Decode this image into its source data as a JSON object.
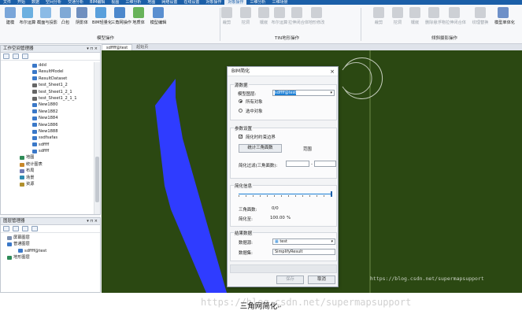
{
  "menu": [
    "文件",
    "开始",
    "数据",
    "空间分析",
    "交通分析",
    "BIM编辑",
    "视图",
    "三维分析",
    "地图",
    "网络设置",
    "在线设置",
    "对象操作",
    "对象操作",
    "三维分析",
    "三维场景"
  ],
  "menu_active": 12,
  "ribbon": {
    "buttons": [
      "建模",
      "布尔运算",
      "截面与投影",
      "凸包",
      "阴影体",
      "BIM轻量化",
      "三角网操作",
      "地质体",
      "模型编辑",
      "裁剪",
      "挖洞",
      "镶嵌",
      "布尔运算",
      "拉伸闭合体",
      "地形修改",
      "裁剪",
      "挖洞",
      "镶嵌",
      "删除悬浮物",
      "拉伸闭合体",
      "纹理替换",
      "模型单体化"
    ],
    "groups": [
      "模型操作",
      "TIN地形操作",
      "倾斜摄影操作"
    ]
  },
  "workspace": {
    "title": "工作空间管理器",
    "tree": [
      "ddd",
      "ResultModel",
      "ResultDataset",
      "test_Sheet1_2",
      "test_Sheet1_2_1",
      "test_Sheet1_2_1_1",
      "New1880",
      "New1882",
      "New1884",
      "New1886",
      "New1888",
      "ssdfsafas",
      "sdffff",
      "sdffff",
      "地图",
      "统计图表",
      "布局",
      "场景",
      "资源"
    ]
  },
  "layers": {
    "title": "图层管理器",
    "tree": [
      "屏幕图层",
      "普通图层",
      "sdffff@test",
      "地形图层"
    ]
  },
  "tabs": [
    "sdffff@test",
    "起始页"
  ],
  "dialog": {
    "title": "BIM简化",
    "source": {
      "title": "源数据",
      "model_layer_label": "模型图层:",
      "model_layer_value": "sdffff@test",
      "all_objects": "所有对象",
      "selected_objects": "选中对象"
    },
    "params": {
      "title": "参数设置",
      "constraint_label": "简化时约束边界",
      "count_button": "统计三角面数",
      "range_label": "范围",
      "filter_label": "简化过滤(三角面数):",
      "filter_from": "",
      "filter_to": ""
    },
    "info": {
      "title": "简化信息",
      "triangles_label": "三角面数:",
      "triangles_value": "0/0",
      "simplify_label": "简化至:",
      "simplify_value": "100.00",
      "percent": "%"
    },
    "result": {
      "title": "结果数据",
      "datasource_label": "数据源:",
      "datasource_value": "test",
      "dataset_label": "数据集:",
      "dataset_value": "SimplifyResult"
    },
    "save_button": "保存",
    "cancel_button": "取消"
  },
  "watermark": "https://blog.csdn.net/supermapsupport",
  "caption": "三角网简化"
}
